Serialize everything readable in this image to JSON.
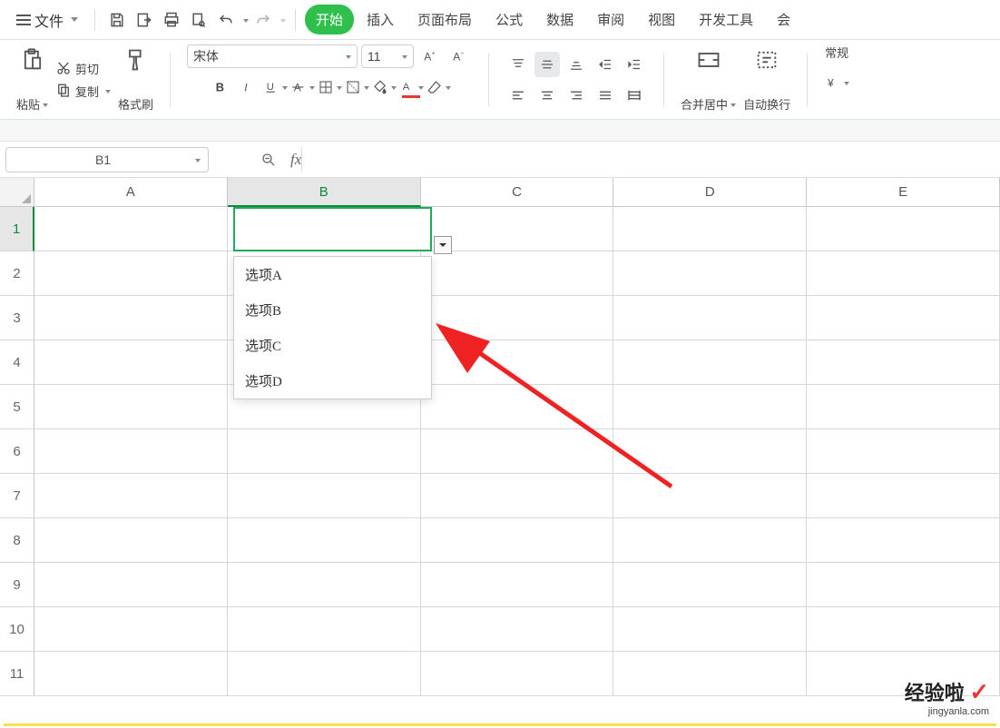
{
  "topbar": {
    "file_label": "文件",
    "tabs": [
      "开始",
      "插入",
      "页面布局",
      "公式",
      "数据",
      "审阅",
      "视图",
      "开发工具",
      "会"
    ]
  },
  "clipboard": {
    "paste_label": "粘贴",
    "cut_label": "剪切",
    "copy_label": "复制",
    "format_painter_label": "格式刷"
  },
  "font": {
    "family": "宋体",
    "size": "11"
  },
  "merge_label": "合并居中",
  "wrap_label": "自动换行",
  "number_format_label": "常规",
  "namebox": {
    "value": "B1"
  },
  "columns": [
    "A",
    "B",
    "C",
    "D",
    "E"
  ],
  "rows": [
    "1",
    "2",
    "3",
    "4",
    "5",
    "6",
    "7",
    "8",
    "9",
    "10",
    "11"
  ],
  "selected_col_index": 1,
  "selected_row_index": 0,
  "dropdown": {
    "options": [
      "选项A",
      "选项B",
      "选项C",
      "选项D"
    ]
  },
  "watermark": {
    "brand": "经验啦",
    "url": "jingyanla.com"
  }
}
